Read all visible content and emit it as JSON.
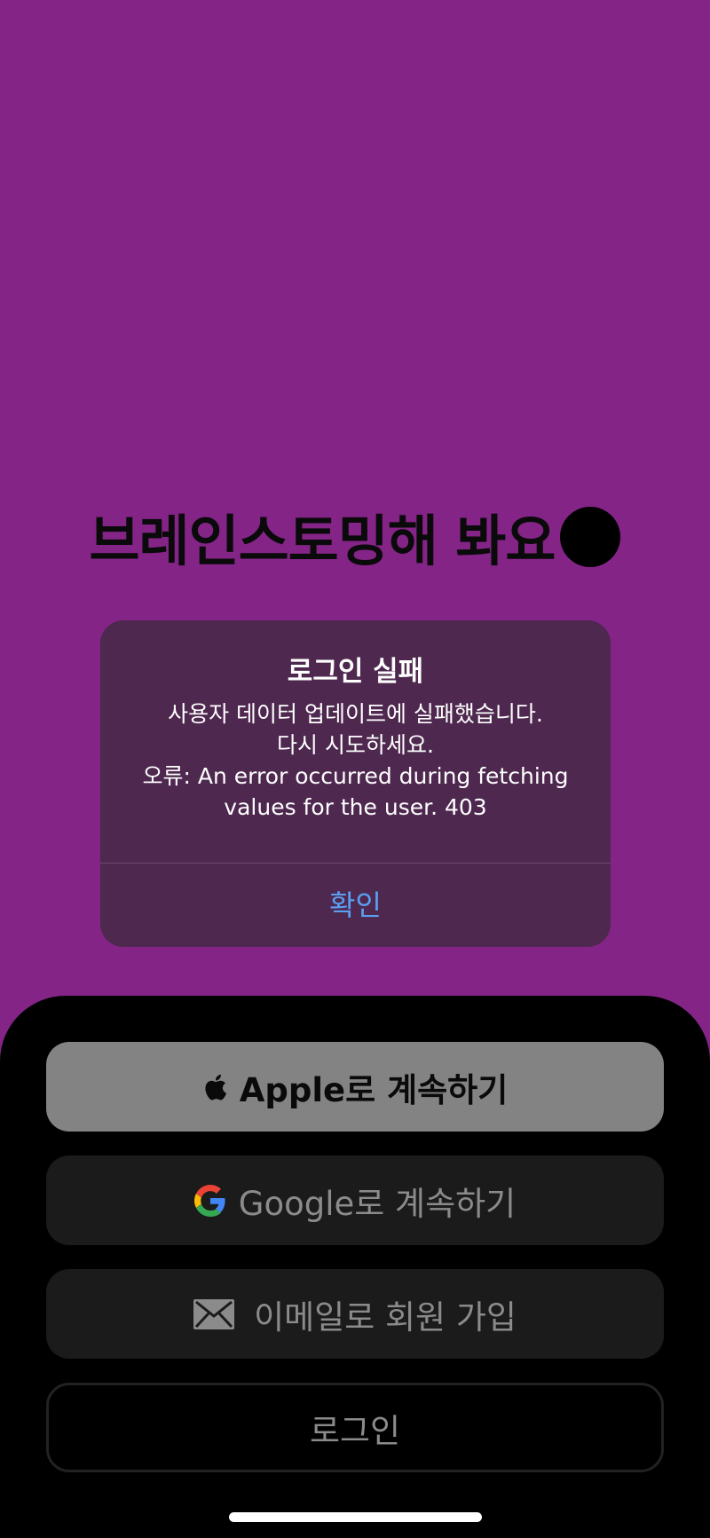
{
  "background_color": "#842487",
  "headline": {
    "text": "브레인스토밍해 봐요"
  },
  "alert": {
    "title": "로그인 실패",
    "message_lines": [
      "사용자 데이터 업데이트에 실패했습니다.",
      "다시 시도하세요.",
      "오류: An error occurred during fetching",
      "values for the user. 403"
    ],
    "confirm_label": "확인",
    "accent_color": "#5aa0f2"
  },
  "auth_buttons": {
    "apple": {
      "label": "Apple로 계속하기",
      "icon": "apple-logo-icon"
    },
    "google": {
      "label": "Google로 계속하기",
      "icon": "google-logo-icon"
    },
    "email": {
      "label": "이메일로 회원 가입",
      "icon": "envelope-icon"
    },
    "login": {
      "label": "로그인"
    }
  }
}
